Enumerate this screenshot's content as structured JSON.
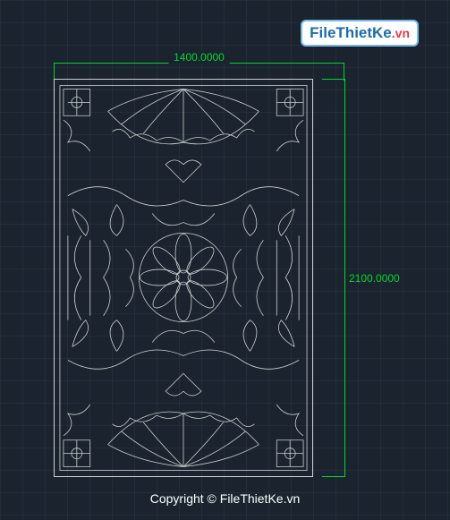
{
  "watermark": {
    "main": "FileThietKe",
    "suffix": ".vn"
  },
  "dimensions": {
    "width_label": "1400.0000",
    "height_label": "2100.0000"
  },
  "colors": {
    "dimension": "#00d930",
    "background": "#1a232e",
    "drawing_stroke": "#d0d0d0"
  },
  "copyright": "Copyright © FileThietKe.vn",
  "drawing": {
    "type": "decorative-cnc-panel",
    "width_mm": 1400,
    "height_mm": 2100
  }
}
